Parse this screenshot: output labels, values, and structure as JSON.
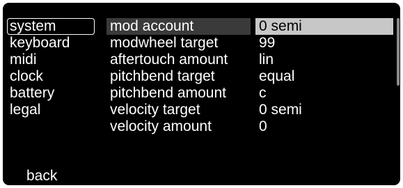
{
  "menu": {
    "items": [
      {
        "label": "system",
        "selected": true
      },
      {
        "label": "keyboard"
      },
      {
        "label": "midi"
      },
      {
        "label": "clock"
      },
      {
        "label": "battery"
      },
      {
        "label": "legal"
      }
    ],
    "back_label": "back"
  },
  "params": [
    {
      "name": "mod account",
      "value": "0 semi"
    },
    {
      "name": "modwheel target",
      "value": "99"
    },
    {
      "name": "aftertouch amount",
      "value": "lin"
    },
    {
      "name": "pitchbend target",
      "value": "equal"
    },
    {
      "name": "pitchbend amount",
      "value": "c"
    },
    {
      "name": "velocity target",
      "value": "0 semi"
    },
    {
      "name": "velocity amount",
      "value": "0"
    }
  ],
  "colors": {
    "background": "#000000",
    "text": "#ffffff",
    "param_highlight": "#3a3a3a",
    "value_selected": "#c7c7c7",
    "scrollbar": "#8a8a8a"
  }
}
